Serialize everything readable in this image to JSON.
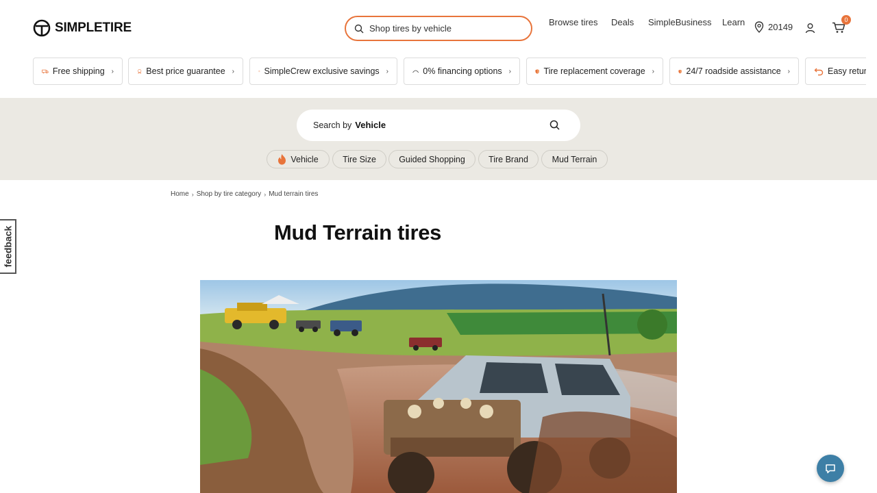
{
  "header": {
    "logo_text": "SIMPLETIRE",
    "search_placeholder": "Shop tires by vehicle",
    "nav": {
      "browse": "Browse tires",
      "deals": "Deals",
      "business": "SimpleBusiness",
      "learn": "Learn",
      "zip": "20149",
      "cart_count": "0"
    }
  },
  "benefits": [
    {
      "label": "Free shipping",
      "icon": "truck-icon"
    },
    {
      "label": "Best price guarantee",
      "icon": "badge-icon"
    },
    {
      "label": "SimpleCrew exclusive savings",
      "icon": "coin-icon"
    },
    {
      "label": "0% financing options",
      "icon": "affirm-icon"
    },
    {
      "label": "Tire replacement coverage",
      "icon": "shield-icon"
    },
    {
      "label": "24/7 roadside assistance",
      "icon": "shield-icon"
    },
    {
      "label": "Easy returns",
      "icon": "return-icon"
    }
  ],
  "vehicle_search": {
    "label": "Search by",
    "kind": "Vehicle"
  },
  "chips": [
    "Vehicle",
    "Tire Size",
    "Guided Shopping",
    "Tire Brand",
    "Mud Terrain"
  ],
  "breadcrumb": {
    "home": "Home",
    "category": "Shop by tire category",
    "current": "Mud terrain tires"
  },
  "page_title": "Mud Terrain tires",
  "feedback_label": "feedback",
  "colors": {
    "accent": "#e8743b",
    "band": "#ebe9e3",
    "chat": "#3d7fa6"
  }
}
